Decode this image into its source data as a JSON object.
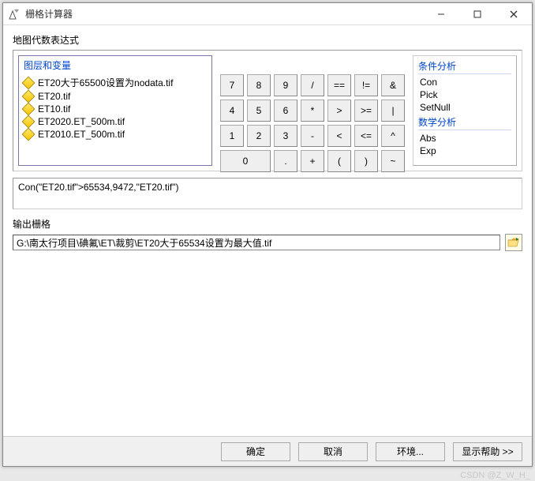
{
  "window": {
    "title": "栅格计算器"
  },
  "section_expr_label": "地图代数表达式",
  "layers": {
    "title": "图层和变量",
    "items": [
      {
        "label": "ET20大于65500设置为nodata.tif"
      },
      {
        "label": "ET20.tif"
      },
      {
        "label": "ET10.tif"
      },
      {
        "label": "ET2020.ET_500m.tif"
      },
      {
        "label": "ET2010.ET_500m.tif"
      }
    ]
  },
  "keypad": {
    "r0": [
      "7",
      "8",
      "9",
      "/",
      "==",
      "!=",
      "&"
    ],
    "r1": [
      "4",
      "5",
      "6",
      "*",
      "> ",
      ">=",
      "|"
    ],
    "r2": [
      "1",
      "2",
      "3",
      "-",
      "< ",
      "<=",
      "^"
    ],
    "r3": [
      "0",
      ".",
      "+",
      "(",
      ")",
      "~"
    ]
  },
  "tools": {
    "group1_title": "条件分析",
    "group1_items": [
      "Con",
      "Pick",
      "SetNull"
    ],
    "group2_title": "数学分析",
    "group2_items": [
      "Abs",
      "Exp"
    ]
  },
  "expression": "Con(\"ET20.tif\">65534,9472,\"ET20.tif\")",
  "output": {
    "label": "输出栅格",
    "path": "G:\\南太行项目\\碘氟\\ET\\裁剪\\ET20大于65534设置为最大值.tif"
  },
  "buttons": {
    "ok": "确定",
    "cancel": "取消",
    "env": "环境...",
    "help": "显示帮助 >>"
  },
  "watermark": "CSDN @Z_W_H_"
}
